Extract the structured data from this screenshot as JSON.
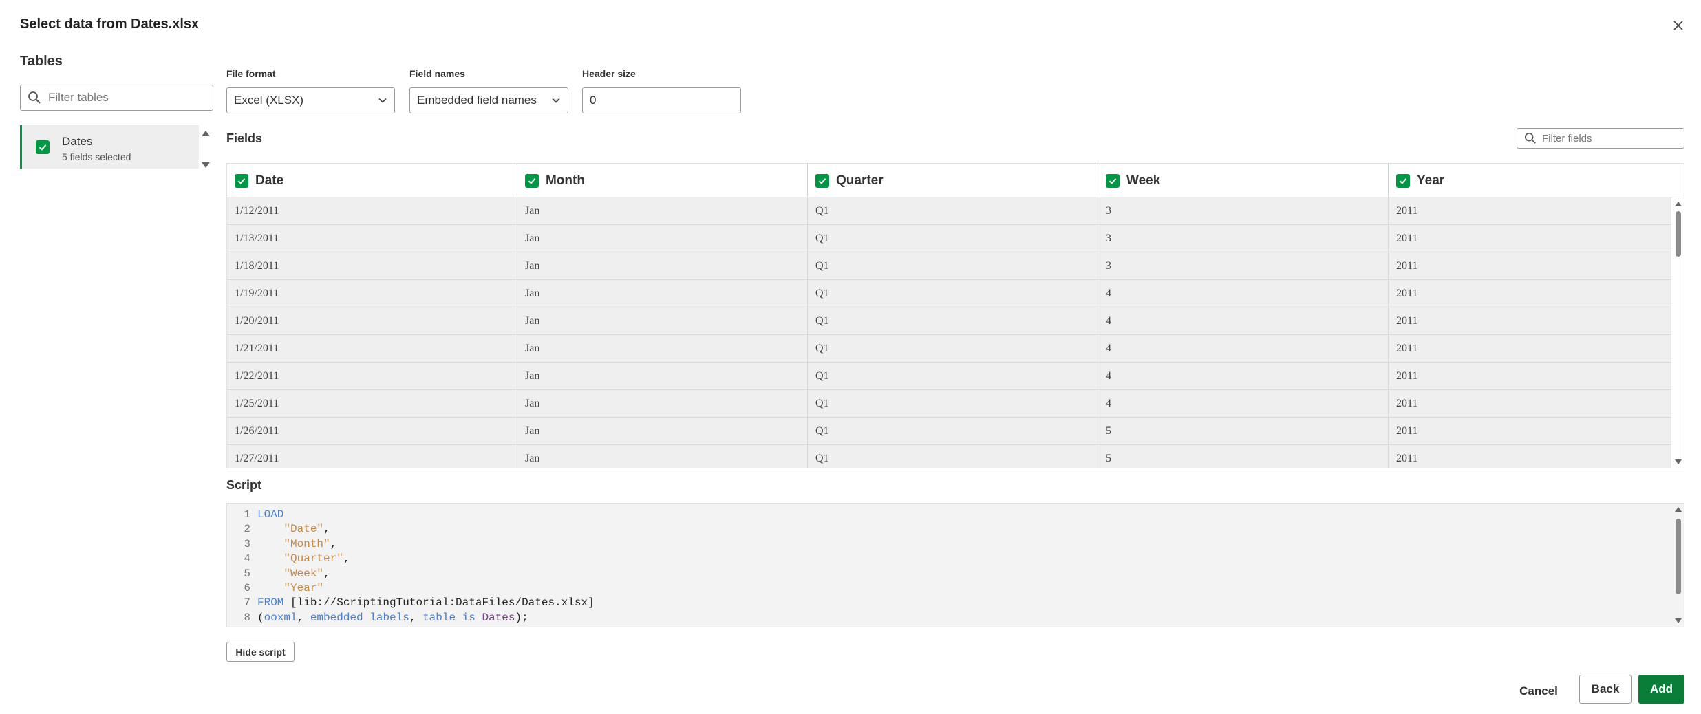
{
  "dialog": {
    "title": "Select data from Dates.xlsx",
    "close_icon": "close-icon"
  },
  "tables_panel": {
    "heading": "Tables",
    "filter_placeholder": "Filter tables",
    "items": [
      {
        "name": "Dates",
        "subtitle": "5 fields selected",
        "checked": true
      }
    ]
  },
  "options": {
    "file_format": {
      "label": "File format",
      "value": "Excel (XLSX)"
    },
    "field_names": {
      "label": "Field names",
      "value": "Embedded field names"
    },
    "header_size": {
      "label": "Header size",
      "value": "0"
    }
  },
  "fields": {
    "heading": "Fields",
    "filter_placeholder": "Filter fields",
    "columns": [
      {
        "label": "Date",
        "checked": true
      },
      {
        "label": "Month",
        "checked": true
      },
      {
        "label": "Quarter",
        "checked": true
      },
      {
        "label": "Week",
        "checked": true
      },
      {
        "label": "Year",
        "checked": true
      }
    ],
    "rows": [
      [
        "1/12/2011",
        "Jan",
        "Q1",
        "3",
        "2011"
      ],
      [
        "1/13/2011",
        "Jan",
        "Q1",
        "3",
        "2011"
      ],
      [
        "1/18/2011",
        "Jan",
        "Q1",
        "3",
        "2011"
      ],
      [
        "1/19/2011",
        "Jan",
        "Q1",
        "4",
        "2011"
      ],
      [
        "1/20/2011",
        "Jan",
        "Q1",
        "4",
        "2011"
      ],
      [
        "1/21/2011",
        "Jan",
        "Q1",
        "4",
        "2011"
      ],
      [
        "1/22/2011",
        "Jan",
        "Q1",
        "4",
        "2011"
      ],
      [
        "1/25/2011",
        "Jan",
        "Q1",
        "4",
        "2011"
      ],
      [
        "1/26/2011",
        "Jan",
        "Q1",
        "5",
        "2011"
      ],
      [
        "1/27/2011",
        "Jan",
        "Q1",
        "5",
        "2011"
      ]
    ]
  },
  "script": {
    "heading": "Script",
    "line_numbers": [
      "1",
      "2",
      "3",
      "4",
      "5",
      "6",
      "7",
      "8"
    ],
    "tokens": {
      "load": "LOAD",
      "f1": "\"Date\"",
      "f2": "\"Month\"",
      "f3": "\"Quarter\"",
      "f4": "\"Week\"",
      "f5": "\"Year\"",
      "comma": ",",
      "from": "FROM",
      "path": " [lib://ScriptingTutorial:DataFiles/Dates.xlsx]",
      "open_paren": "(",
      "ooxml": "ooxml",
      "sep": ", ",
      "embedded": "embedded labels",
      "table_is": "table is",
      "space": " ",
      "table_name": "Dates",
      "close": ");"
    }
  },
  "buttons": {
    "hide_script": "Hide script",
    "cancel": "Cancel",
    "back": "Back",
    "add": "Add"
  },
  "colors": {
    "accent_green": "#009845",
    "add_button": "#0a7d39",
    "keyword": "#4a7fd1",
    "string": "#c6873f",
    "table_name": "#7b3a8a"
  }
}
